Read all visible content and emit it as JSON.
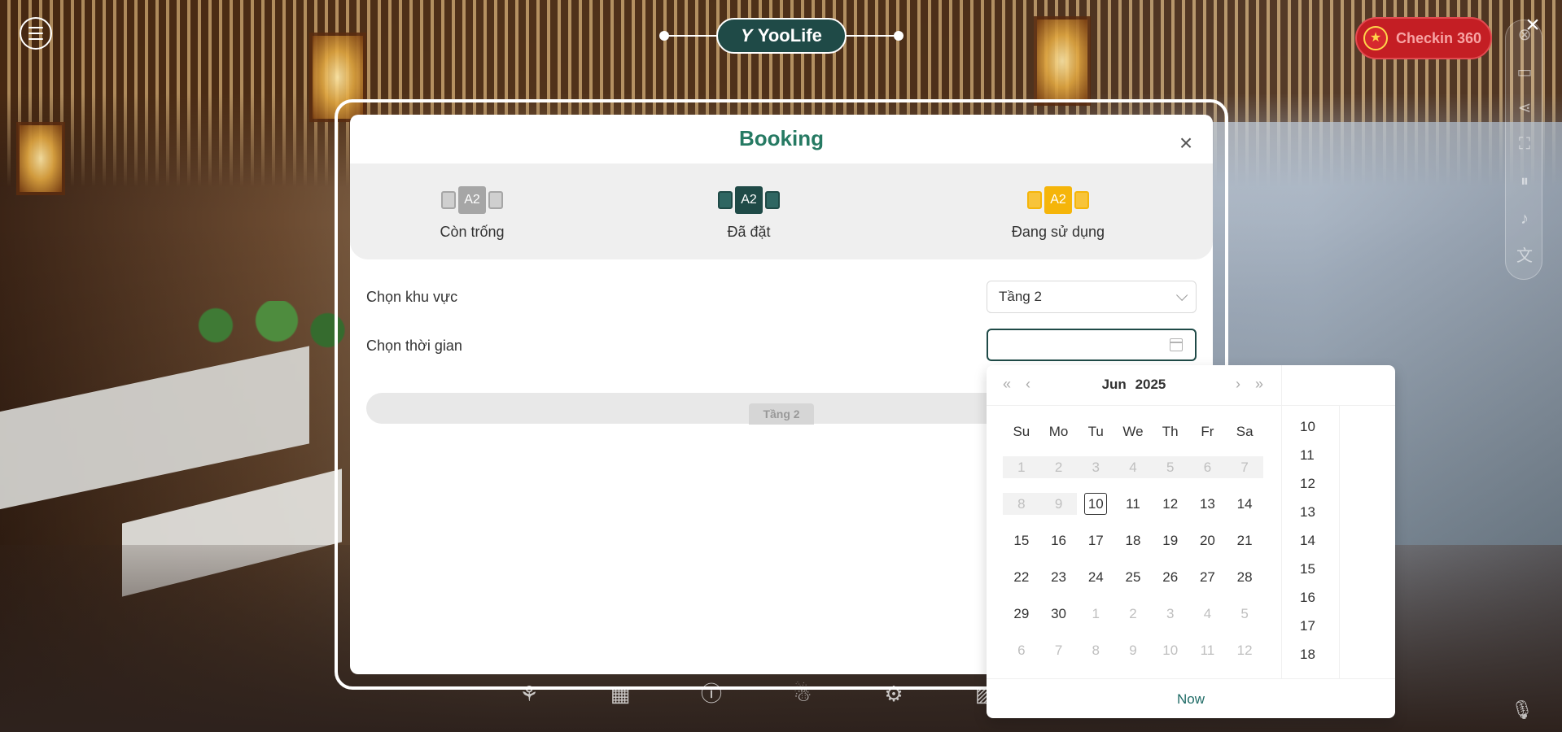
{
  "brand": {
    "name": "YooLife",
    "logo_mark": "Y"
  },
  "checkin": {
    "label": "Checkin 360",
    "icon": "vietnam-flag-icon"
  },
  "modal": {
    "title": "Booking",
    "legend": [
      {
        "table": "A2",
        "label": "Còn trống",
        "color": "#a6a6a6"
      },
      {
        "table": "A2",
        "label": "Đã đặt",
        "color": "#1f4a47"
      },
      {
        "table": "A2",
        "label": "Đang sử dụng",
        "color": "#f5b50a"
      }
    ],
    "area": {
      "label": "Chọn khu vực",
      "value": "Tầng 2"
    },
    "time": {
      "label": "Chọn thời gian",
      "value": ""
    },
    "area_tab": "Tầng 2"
  },
  "picker": {
    "month": "Jun",
    "year": "2025",
    "weekdays": [
      "Su",
      "Mo",
      "Tu",
      "We",
      "Th",
      "Fr",
      "Sa"
    ],
    "weeks": [
      [
        "1",
        "2",
        "3",
        "4",
        "5",
        "6",
        "7"
      ],
      [
        "8",
        "9",
        "10",
        "11",
        "12",
        "13",
        "14"
      ],
      [
        "15",
        "16",
        "17",
        "18",
        "19",
        "20",
        "21"
      ],
      [
        "22",
        "23",
        "24",
        "25",
        "26",
        "27",
        "28"
      ],
      [
        "29",
        "30",
        "1",
        "2",
        "3",
        "4",
        "5"
      ],
      [
        "6",
        "7",
        "8",
        "9",
        "10",
        "11",
        "12"
      ]
    ],
    "today": "10",
    "hours": [
      "10",
      "11",
      "12",
      "13",
      "14",
      "15",
      "16",
      "17",
      "18"
    ],
    "now_label": "Now"
  },
  "colors": {
    "accent": "#1f4a47",
    "title": "#267a63",
    "checkin": "#c41e24"
  }
}
